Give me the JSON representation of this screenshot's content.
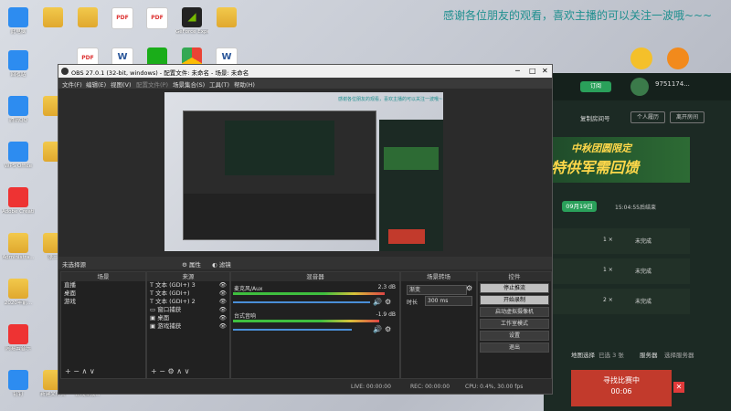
{
  "banner": "感谢各位朋友的观看，喜欢主播的可以关注一波哦~~~",
  "desktop": {
    "icons": [
      {
        "label": "此电脑"
      },
      {
        "label": "回收站"
      },
      {
        "label": "腾讯QQ"
      },
      {
        "label": "WPS Office"
      },
      {
        "label": "Adobe Creati..."
      },
      {
        "label": "Administra..."
      },
      {
        "label": "张三"
      },
      {
        "label": "2020年前..."
      },
      {
        "label": "网易云音乐"
      },
      {
        "label": "钉钉"
      },
      {
        "label": "GeForce Experience"
      },
      {
        "label": "新建文件夹"
      },
      {
        "label": "游戏集成..."
      }
    ]
  },
  "obs": {
    "title": "OBS 27.0.1 (32-bit, windows) - 配置文件: 未命名 - 场景: 未命名",
    "menu": [
      "文件(F)",
      "编辑(E)",
      "视图(V)",
      "配置文件(P)",
      "场景集合(S)",
      "工具(T)",
      "帮助(H)"
    ],
    "scene_label": "未选择源",
    "properties_label": "属性",
    "filters_label": "滤镜",
    "docks": {
      "scenes": {
        "title": "场景",
        "items": [
          "直播",
          "桌面",
          "游戏"
        ]
      },
      "sources": {
        "title": "来源",
        "items": [
          "文本 (GDI+) 3",
          "文本 (GDI+)",
          "文本 (GDI+) 2",
          "窗口捕获",
          "桌面",
          "游戏捕获"
        ]
      },
      "mixer": {
        "title": "混音器",
        "channels": [
          {
            "name": "麦克风/Aux",
            "db": "2.3 dB",
            "level_pct": 92
          },
          {
            "name": "台式音响",
            "db": "-1.9 dB",
            "level_pct": 85
          }
        ]
      },
      "transitions": {
        "title": "场景转场",
        "type": "渐变",
        "duration_label": "时长",
        "duration": "300 ms"
      },
      "controls": {
        "title": "控件",
        "buttons": [
          "停止推流",
          "开始录制",
          "启动虚拟摄像机",
          "工作室模式",
          "设置",
          "退出"
        ]
      }
    },
    "status": {
      "live": "LIVE: 00:00:00",
      "rec": "REC: 00:00:00",
      "cpu": "CPU: 0.4%, 30.00 fps"
    }
  },
  "game": {
    "follow_button": "订阅",
    "user_id": "9751174...",
    "copy_room": "复制房间号",
    "personal": "个人履历",
    "exit_room": "离开房间",
    "hero_title": "中秋团圆限定",
    "hero_title2": "特供军需回馈",
    "date": "09月19日",
    "time": "15:04:55后结束",
    "rows": [
      {
        "count": "1 ×",
        "status": "未完成"
      },
      {
        "count": "1 ×",
        "status": "未完成"
      },
      {
        "count": "2 ×",
        "status": "未完成"
      }
    ],
    "map_select": "地图选择",
    "map_value": "已选 3 张",
    "server": "服务器",
    "server_value": "选择服务器",
    "match_title": "寻找比赛中",
    "match_timer": "00:06"
  },
  "colors": {
    "obs_bg": "#2b2b2b",
    "accent_green": "#2aa05a",
    "match_red": "#c23a2c",
    "banner": "#1f8f8f"
  }
}
